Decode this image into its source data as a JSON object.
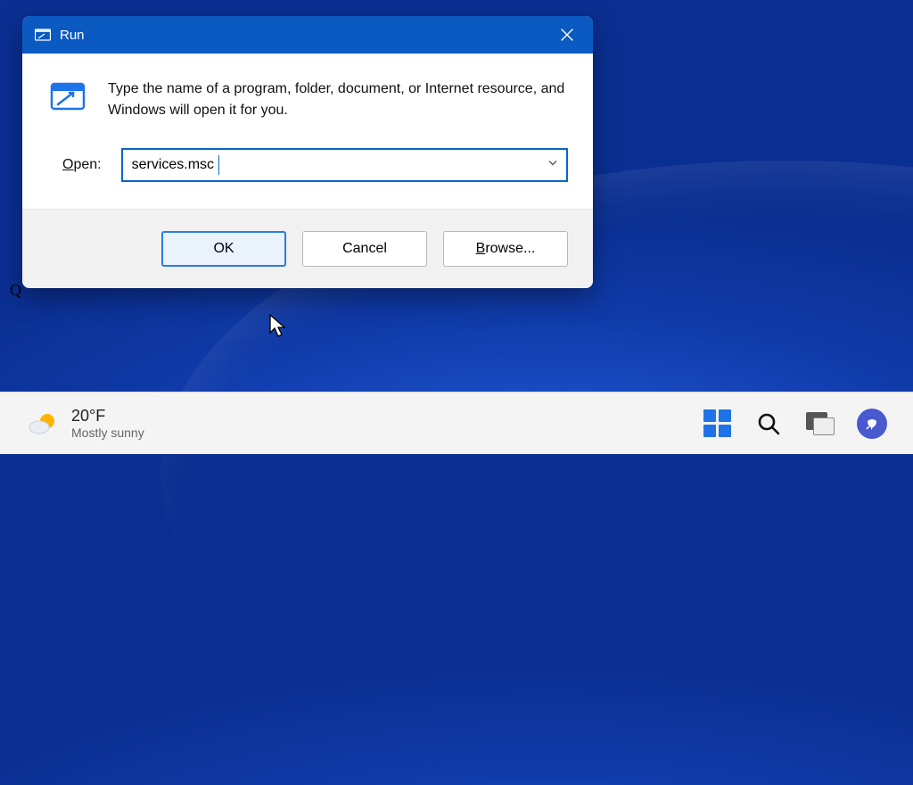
{
  "dialog": {
    "title": "Run",
    "description": "Type the name of a program, folder, document, or Internet resource, and Windows will open it for you.",
    "open_label_html": "Open:",
    "open_underline_char": "O",
    "input_value": "services.msc",
    "buttons": {
      "ok": "OK",
      "cancel": "Cancel",
      "browse": "Browse...",
      "browse_underline_char": "B"
    }
  },
  "stray_char": "Q",
  "taskbar": {
    "weather": {
      "temp": "20°F",
      "condition": "Mostly sunny"
    }
  }
}
